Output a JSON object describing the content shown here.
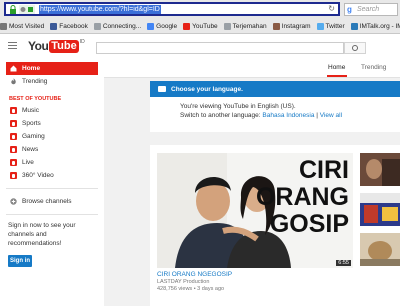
{
  "browser": {
    "url": "https://www.youtube.com/?hl=id&gl=ID",
    "search_placeholder": "Search",
    "search_engine_letter": "g"
  },
  "bookmarks": [
    {
      "label": "Most Visited",
      "icon": "gear-icon",
      "color": "#777777"
    },
    {
      "label": "Facebook",
      "icon": "facebook-icon",
      "color": "#3b5998"
    },
    {
      "label": "Connecting...",
      "icon": "page-icon",
      "color": "#9aa0a6"
    },
    {
      "label": "Google",
      "icon": "google-icon",
      "color": "#4285f4"
    },
    {
      "label": "YouTube",
      "icon": "youtube-icon",
      "color": "#e62117"
    },
    {
      "label": "Terjemahan",
      "icon": "translate-icon",
      "color": "#9aa0a6"
    },
    {
      "label": "Instagram",
      "icon": "instagram-icon",
      "color": "#8a5a44"
    },
    {
      "label": "Twitter",
      "icon": "twitter-icon",
      "color": "#55acee"
    },
    {
      "label": "IMTalk.org - IMT Web...",
      "icon": "imtalk-icon",
      "color": "#2a7ab8"
    }
  ],
  "youtube": {
    "logo_you": "You",
    "logo_tube": "Tube",
    "logo_suffix": "ID"
  },
  "sidebar": {
    "nav": [
      {
        "label": "Home",
        "active": true
      },
      {
        "label": "Trending",
        "active": false
      }
    ],
    "best_heading": "BEST OF YOUTUBE",
    "categories": [
      "Music",
      "Sports",
      "Gaming",
      "News",
      "Live",
      "360° Video"
    ],
    "browse_channels": "Browse channels",
    "signin_text": "Sign in now to see your channels and recommendations!",
    "signin_button": "Sign in"
  },
  "tabs": {
    "home": "Home",
    "trending": "Trending"
  },
  "language_card": {
    "title": "Choose your language.",
    "line1": "You're viewing YouTube in English (US).",
    "line2_prefix": "Switch to another language:",
    "line2_link1": "Bahasa Indonesia",
    "line2_sep": " | ",
    "line2_link2": "View all"
  },
  "video": {
    "thumbnail_text": [
      "CIRI",
      "ORANG",
      "GOSIP"
    ],
    "duration": "6:55",
    "title": "CIRI ORANG NGEGOSIP",
    "channel": "LASTDAY Production",
    "views": "428,756 views",
    "age": "3 days ago"
  },
  "colors": {
    "accent_red": "#e62117",
    "accent_blue": "#167ac6"
  }
}
